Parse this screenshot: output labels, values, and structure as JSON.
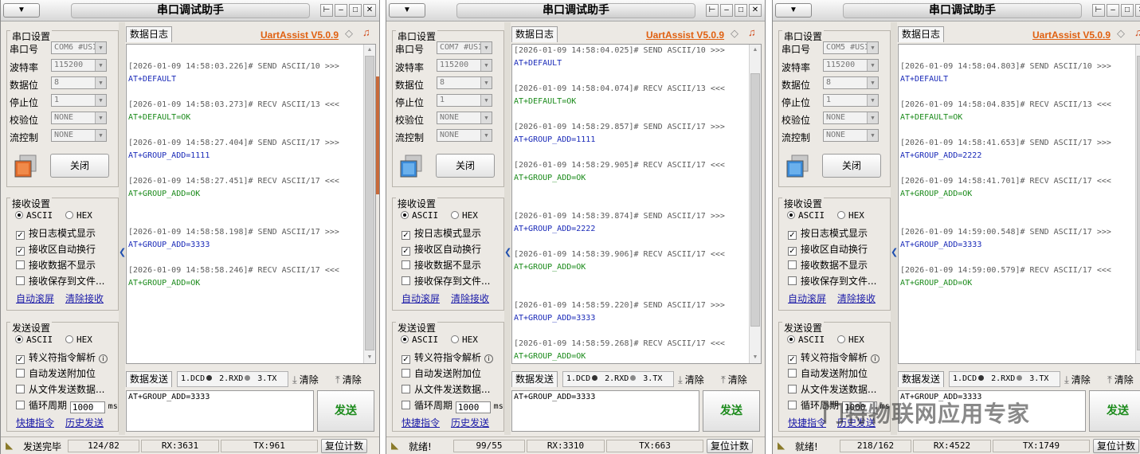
{
  "common": {
    "app_title": "串口调试助手",
    "brand": "UartAssist V5.0.9",
    "serial_group": "串口设置",
    "port_label": "串口号",
    "baud_label": "波特率",
    "data_label": "数据位",
    "stop_label": "停止位",
    "parity_label": "校验位",
    "flow_label": "流控制",
    "close_button": "关闭",
    "recv_group": "接收设置",
    "ascii": "ASCII",
    "hex": "HEX",
    "recv_opt1": "按日志模式显示",
    "recv_opt2": "接收区自动换行",
    "recv_opt3": "接收数据不显示",
    "recv_opt4": "接收保存到文件...",
    "auto_scroll": "自动滚屏",
    "clear_recv": "清除接收",
    "send_group": "发送设置",
    "send_opt1": "转义符指令解析",
    "send_opt2": "自动发送附加位",
    "send_opt3": "从文件发送数据...",
    "send_opt4": "循环周期",
    "cycle_value": "1000",
    "cycle_unit": "ms",
    "shortcuts": "快捷指令",
    "history": "历史发送",
    "log_tab": "数据日志",
    "send_tab": "数据发送",
    "dcd": "1.DCD",
    "rxd": "2.RXD",
    "tx3": "3.TX",
    "clear1": "清除",
    "clear2": "清除",
    "send_text": "AT+GROUP_ADD=3333",
    "send_button": "发送",
    "reset_button": "复位计数",
    "baud": "115200",
    "databits": "8",
    "stopbits": "1",
    "parity": "NONE",
    "flow": "NONE",
    "sysmenu_label": "▼"
  },
  "windows": [
    {
      "port": "COM6 #USI",
      "status": "发送完毕",
      "counter": "124/82",
      "rx": "RX:3631",
      "tx": "TX:961",
      "log": [
        {
          "type": "gap"
        },
        {
          "type": "ts",
          "text": "[2026-01-09 14:58:03.226]# SEND ASCII/10 >>>"
        },
        {
          "type": "send",
          "text": "AT+DEFAULT"
        },
        {
          "type": "gap"
        },
        {
          "type": "ts",
          "text": "[2026-01-09 14:58:03.273]# RECV ASCII/13 <<<"
        },
        {
          "type": "recv",
          "text": "AT+DEFAULT=OK"
        },
        {
          "type": "gap"
        },
        {
          "type": "ts",
          "text": "[2026-01-09 14:58:27.404]# SEND ASCII/17 >>>"
        },
        {
          "type": "send",
          "text": "AT+GROUP_ADD=1111"
        },
        {
          "type": "gap"
        },
        {
          "type": "ts",
          "text": "[2026-01-09 14:58:27.451]# RECV ASCII/17 <<<"
        },
        {
          "type": "recv",
          "text": "AT+GROUP_ADD=OK"
        },
        {
          "type": "gap"
        },
        {
          "type": "gap"
        },
        {
          "type": "ts",
          "text": "[2026-01-09 14:58:58.198]# SEND ASCII/17 >>>"
        },
        {
          "type": "send",
          "text": "AT+GROUP_ADD=3333"
        },
        {
          "type": "gap"
        },
        {
          "type": "ts",
          "text": "[2026-01-09 14:58:58.246]# RECV ASCII/17 <<<"
        },
        {
          "type": "recv",
          "text": "AT+GROUP_ADD=OK"
        }
      ]
    },
    {
      "port": "COM7 #USI",
      "status": "就绪!",
      "counter": "99/55",
      "rx": "RX:3310",
      "tx": "TX:663",
      "log": [
        {
          "type": "ts",
          "text": "[2026-01-09 14:58:04.025]# SEND ASCII/10 >>>"
        },
        {
          "type": "send",
          "text": "AT+DEFAULT"
        },
        {
          "type": "gap"
        },
        {
          "type": "ts",
          "text": "[2026-01-09 14:58:04.074]# RECV ASCII/13 <<<"
        },
        {
          "type": "recv",
          "text": "AT+DEFAULT=OK"
        },
        {
          "type": "gap"
        },
        {
          "type": "ts",
          "text": "[2026-01-09 14:58:29.857]# SEND ASCII/17 >>>"
        },
        {
          "type": "send",
          "text": "AT+GROUP_ADD=1111"
        },
        {
          "type": "gap"
        },
        {
          "type": "ts",
          "text": "[2026-01-09 14:58:29.905]# RECV ASCII/17 <<<"
        },
        {
          "type": "recv",
          "text": "AT+GROUP_ADD=OK"
        },
        {
          "type": "gap"
        },
        {
          "type": "gap"
        },
        {
          "type": "ts",
          "text": "[2026-01-09 14:58:39.874]# SEND ASCII/17 >>>"
        },
        {
          "type": "send",
          "text": "AT+GROUP_ADD=2222"
        },
        {
          "type": "gap"
        },
        {
          "type": "ts",
          "text": "[2026-01-09 14:58:39.906]# RECV ASCII/17 <<<"
        },
        {
          "type": "recv",
          "text": "AT+GROUP_ADD=OK"
        },
        {
          "type": "gap"
        },
        {
          "type": "gap"
        },
        {
          "type": "ts",
          "text": "[2026-01-09 14:58:59.220]# SEND ASCII/17 >>>"
        },
        {
          "type": "send",
          "text": "AT+GROUP_ADD=3333"
        },
        {
          "type": "gap"
        },
        {
          "type": "ts",
          "text": "[2026-01-09 14:58:59.268]# RECV ASCII/17 <<<"
        },
        {
          "type": "recv",
          "text": "AT+GROUP_ADD=OK"
        }
      ]
    },
    {
      "port": "COM5 #USI",
      "status": "就绪!",
      "counter": "218/162",
      "rx": "RX:4522",
      "tx": "TX:1749",
      "log": [
        {
          "type": "gap"
        },
        {
          "type": "ts",
          "text": "[2026-01-09 14:58:04.803]# SEND ASCII/10 >>>"
        },
        {
          "type": "send",
          "text": "AT+DEFAULT"
        },
        {
          "type": "gap"
        },
        {
          "type": "ts",
          "text": "[2026-01-09 14:58:04.835]# RECV ASCII/13 <<<"
        },
        {
          "type": "recv",
          "text": "AT+DEFAULT=OK"
        },
        {
          "type": "gap"
        },
        {
          "type": "ts",
          "text": "[2026-01-09 14:58:41.653]# SEND ASCII/17 >>>"
        },
        {
          "type": "send",
          "text": "AT+GROUP_ADD=2222"
        },
        {
          "type": "gap"
        },
        {
          "type": "ts",
          "text": "[2026-01-09 14:58:41.701]# RECV ASCII/17 <<<"
        },
        {
          "type": "recv",
          "text": "AT+GROUP_ADD=OK"
        },
        {
          "type": "gap"
        },
        {
          "type": "gap"
        },
        {
          "type": "ts",
          "text": "[2026-01-09 14:59:00.548]# SEND ASCII/17 >>>"
        },
        {
          "type": "send",
          "text": "AT+GROUP_ADD=3333"
        },
        {
          "type": "gap"
        },
        {
          "type": "ts",
          "text": "[2026-01-09 14:59:00.579]# RECV ASCII/17 <<<"
        },
        {
          "type": "recv",
          "text": "AT+GROUP_ADD=OK"
        }
      ]
    }
  ],
  "watermark": "门特物联网应用专家",
  "colors": {
    "brand": "#e06010",
    "send_text": "#1a2ab8",
    "recv_text": "#1a8a1a",
    "timestamp": "#5a5a5a"
  }
}
